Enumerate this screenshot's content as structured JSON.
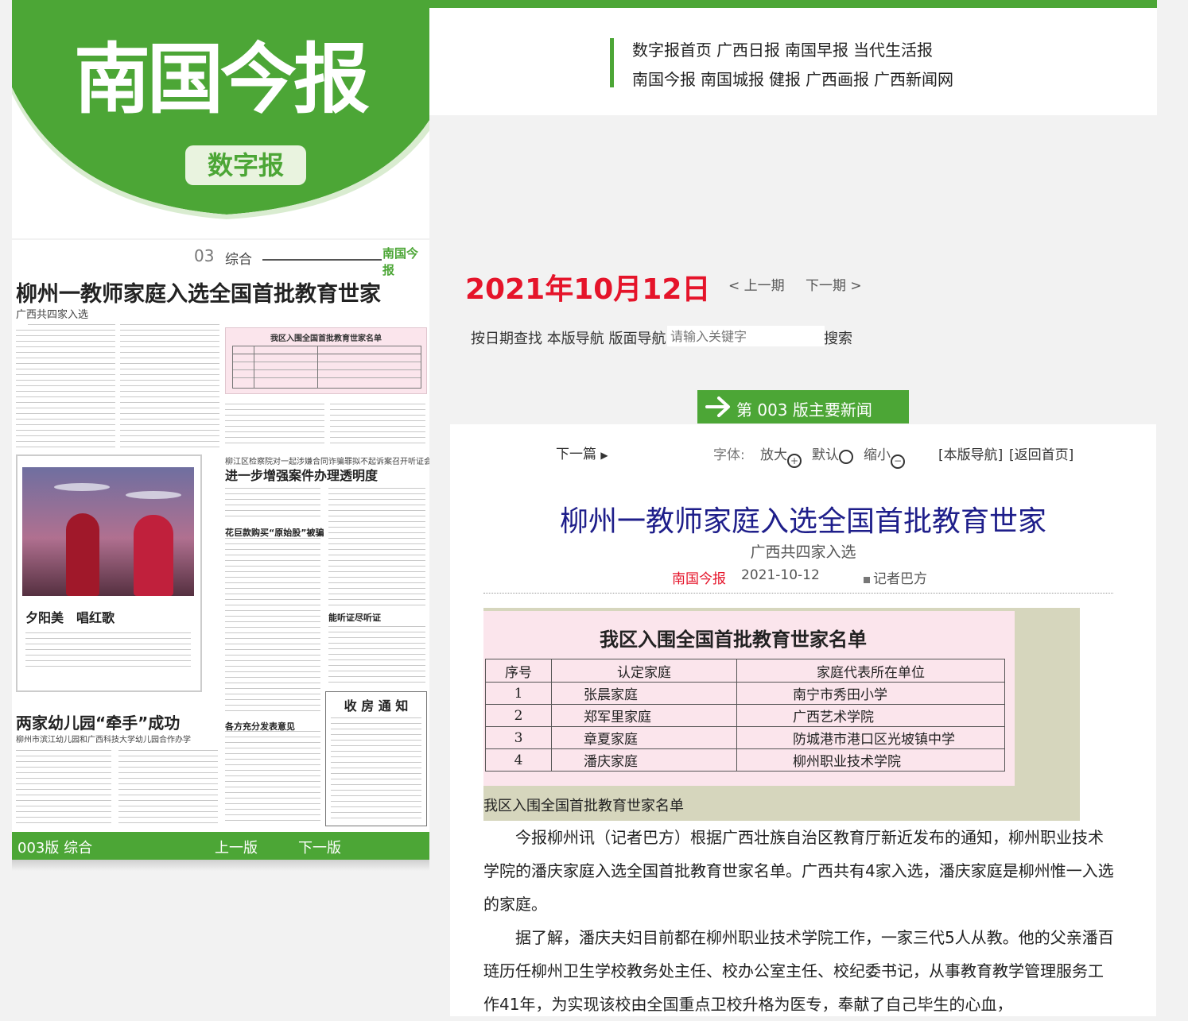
{
  "header": {
    "logo": "南国今报",
    "logo_sub": "数字报",
    "nav_row1": [
      "数字报首页",
      "广西日报",
      "南国早报",
      "当代生活报"
    ],
    "nav_row2": [
      "南国今报",
      "南国城报",
      "健报",
      "广西画报",
      "广西新闻网"
    ]
  },
  "paper": {
    "page_no": "03",
    "section": "综合",
    "masthead_small": "南国今报",
    "headline": "柳州一教师家庭入选全国首批教育世家",
    "subhead": "广西共四家入选",
    "box_title": "我区入围全国首批教育世家名单",
    "photo_caption": "夕阳美　唱红歌",
    "story2_kicker": "柳江区检察院对一起涉嫌合同诈骗罪拟不起诉案召开听证会",
    "story2_title": "进一步增强案件办理透明度",
    "story2_sub1": "花巨款购买“原始股”被骗",
    "story2_sub2": "能听证尽听证",
    "story2_sub3": "各方充分发表意见",
    "story3_title": "两家幼儿园“牵手”成功",
    "story3_sub": "柳州市滨江幼儿园和广西科技大学幼儿园合作办学",
    "notice_title": "收 房 通 知",
    "footer_left": "003版 综合",
    "footer_prev": "上一版",
    "footer_next": "下一版"
  },
  "issue": {
    "date": "2021年10月12日",
    "prev_issue": "< 上一期",
    "next_issue": "下一期 >"
  },
  "tools": {
    "items": [
      "按日期查找",
      "本版导航",
      "版面导航"
    ],
    "search_placeholder": "请输入关键字",
    "search_button": "搜索"
  },
  "tab": {
    "label": "第 003 版主要新闻"
  },
  "controls": {
    "next_article": "下一篇",
    "font_label": "字体:",
    "enlarge": "放大",
    "default": "默认",
    "shrink": "缩小",
    "page_nav": "[本版导航]",
    "back_home": "[返回首页]"
  },
  "article": {
    "title": "柳州一教师家庭入选全国首批教育世家",
    "subtitle": "广西共四家入选",
    "source": "南国今报",
    "date": "2021-10-12",
    "author": "记者巴方",
    "image_caption": "我区入围全国首批教育世家名单",
    "paragraphs": [
      "今报柳州讯（记者巴方）根据广西壮族自治区教育厅新近发布的通知，柳州职业技术学院的潘庆家庭入选全国首批教育世家名单。广西共有4家入选，潘庆家庭是柳州惟一入选的家庭。",
      "据了解，潘庆夫妇目前都在柳州职业技术学院工作，一家三代5人从教。他的父亲潘百琏历任柳州卫生学校教务处主任、校办公室主任、校纪委书记，从事教育教学管理服务工作41年，为实现该校由全国重点卫校升格为医专，奉献了自己毕生的心血，"
    ]
  },
  "table": {
    "title": "我区入围全国首批教育世家名单",
    "headers": [
      "序号",
      "认定家庭",
      "家庭代表所在单位"
    ],
    "rows": [
      [
        "1",
        "张晨家庭",
        "南宁市秀田小学"
      ],
      [
        "2",
        "郑军里家庭",
        "广西艺术学院"
      ],
      [
        "3",
        "章夏家庭",
        "防城港市港口区光坡镇中学"
      ],
      [
        "4",
        "潘庆家庭",
        "柳州职业技术学院"
      ]
    ]
  },
  "colors": {
    "brand_green": "#4ca636",
    "date_red": "#e5142a",
    "title_navy": "#1e1e8a"
  }
}
